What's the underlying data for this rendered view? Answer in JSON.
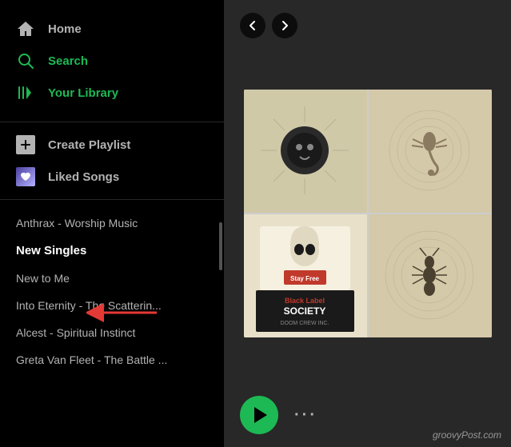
{
  "sidebar": {
    "nav": {
      "home": {
        "label": "Home",
        "active": false
      },
      "search": {
        "label": "Search",
        "active": false
      },
      "library": {
        "label": "Your Library",
        "active": false
      }
    },
    "actions": {
      "create_playlist": {
        "label": "Create Playlist"
      },
      "liked_songs": {
        "label": "Liked Songs"
      }
    },
    "playlists": [
      {
        "id": 1,
        "label": "Anthrax - Worship Music",
        "active": false
      },
      {
        "id": 2,
        "label": "New Singles",
        "active": true
      },
      {
        "id": 3,
        "label": "New to Me",
        "active": false
      },
      {
        "id": 4,
        "label": "Into Eternity - The Scatterin...",
        "active": false
      },
      {
        "id": 5,
        "label": "Alcest - Spiritual Instinct",
        "active": false
      },
      {
        "id": 6,
        "label": "Greta Van Fleet - The Battle ...",
        "active": false
      }
    ]
  },
  "player": {
    "more_dots": "···"
  },
  "watermark": "groovyPost.com",
  "icons": {
    "home": "⌂",
    "search": "○",
    "library": "|||",
    "plus": "+",
    "heart": "♥",
    "left": "‹",
    "right": "›"
  }
}
